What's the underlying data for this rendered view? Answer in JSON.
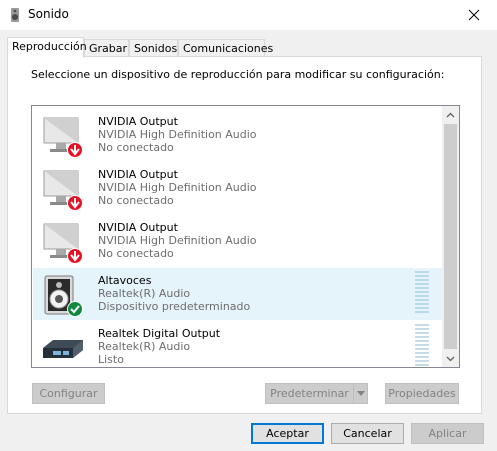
{
  "window": {
    "title": "Sonido"
  },
  "tabs": [
    {
      "label": "Reproducción",
      "active": true
    },
    {
      "label": "Grabar",
      "active": false
    },
    {
      "label": "Sonidos",
      "active": false
    },
    {
      "label": "Comunicaciones",
      "active": false
    }
  ],
  "instruction": "Seleccione un dispositivo de reproducción para modificar su configuración:",
  "devices": [
    {
      "name": "NVIDIA Output",
      "driver": "NVIDIA High Definition Audio",
      "status": "No conectado",
      "icon": "monitor-icon",
      "badge": "disconnected-badge-icon",
      "selected": false
    },
    {
      "name": "NVIDIA Output",
      "driver": "NVIDIA High Definition Audio",
      "status": "No conectado",
      "icon": "monitor-icon",
      "badge": "disconnected-badge-icon",
      "selected": false
    },
    {
      "name": "NVIDIA Output",
      "driver": "NVIDIA High Definition Audio",
      "status": "No conectado",
      "icon": "monitor-icon",
      "badge": "disconnected-badge-icon",
      "selected": false
    },
    {
      "name": "Altavoces",
      "driver": "Realtek(R) Audio",
      "status": "Dispositivo predeterminado",
      "icon": "speaker-icon",
      "badge": "default-check-icon",
      "selected": true
    },
    {
      "name": "Realtek Digital Output",
      "driver": "Realtek(R) Audio",
      "status": "Listo",
      "icon": "digital-output-icon",
      "badge": "",
      "selected": false
    }
  ],
  "buttons": {
    "configure": "Configurar",
    "set_default": "Predeterminar",
    "properties": "Propiedades",
    "accept": "Aceptar",
    "cancel": "Cancelar",
    "apply": "Aplicar"
  },
  "colors": {
    "selection": "#e5f3fb",
    "disconnected_badge": "#e81123",
    "default_badge": "#10893e",
    "focus_border": "#0078d7"
  }
}
